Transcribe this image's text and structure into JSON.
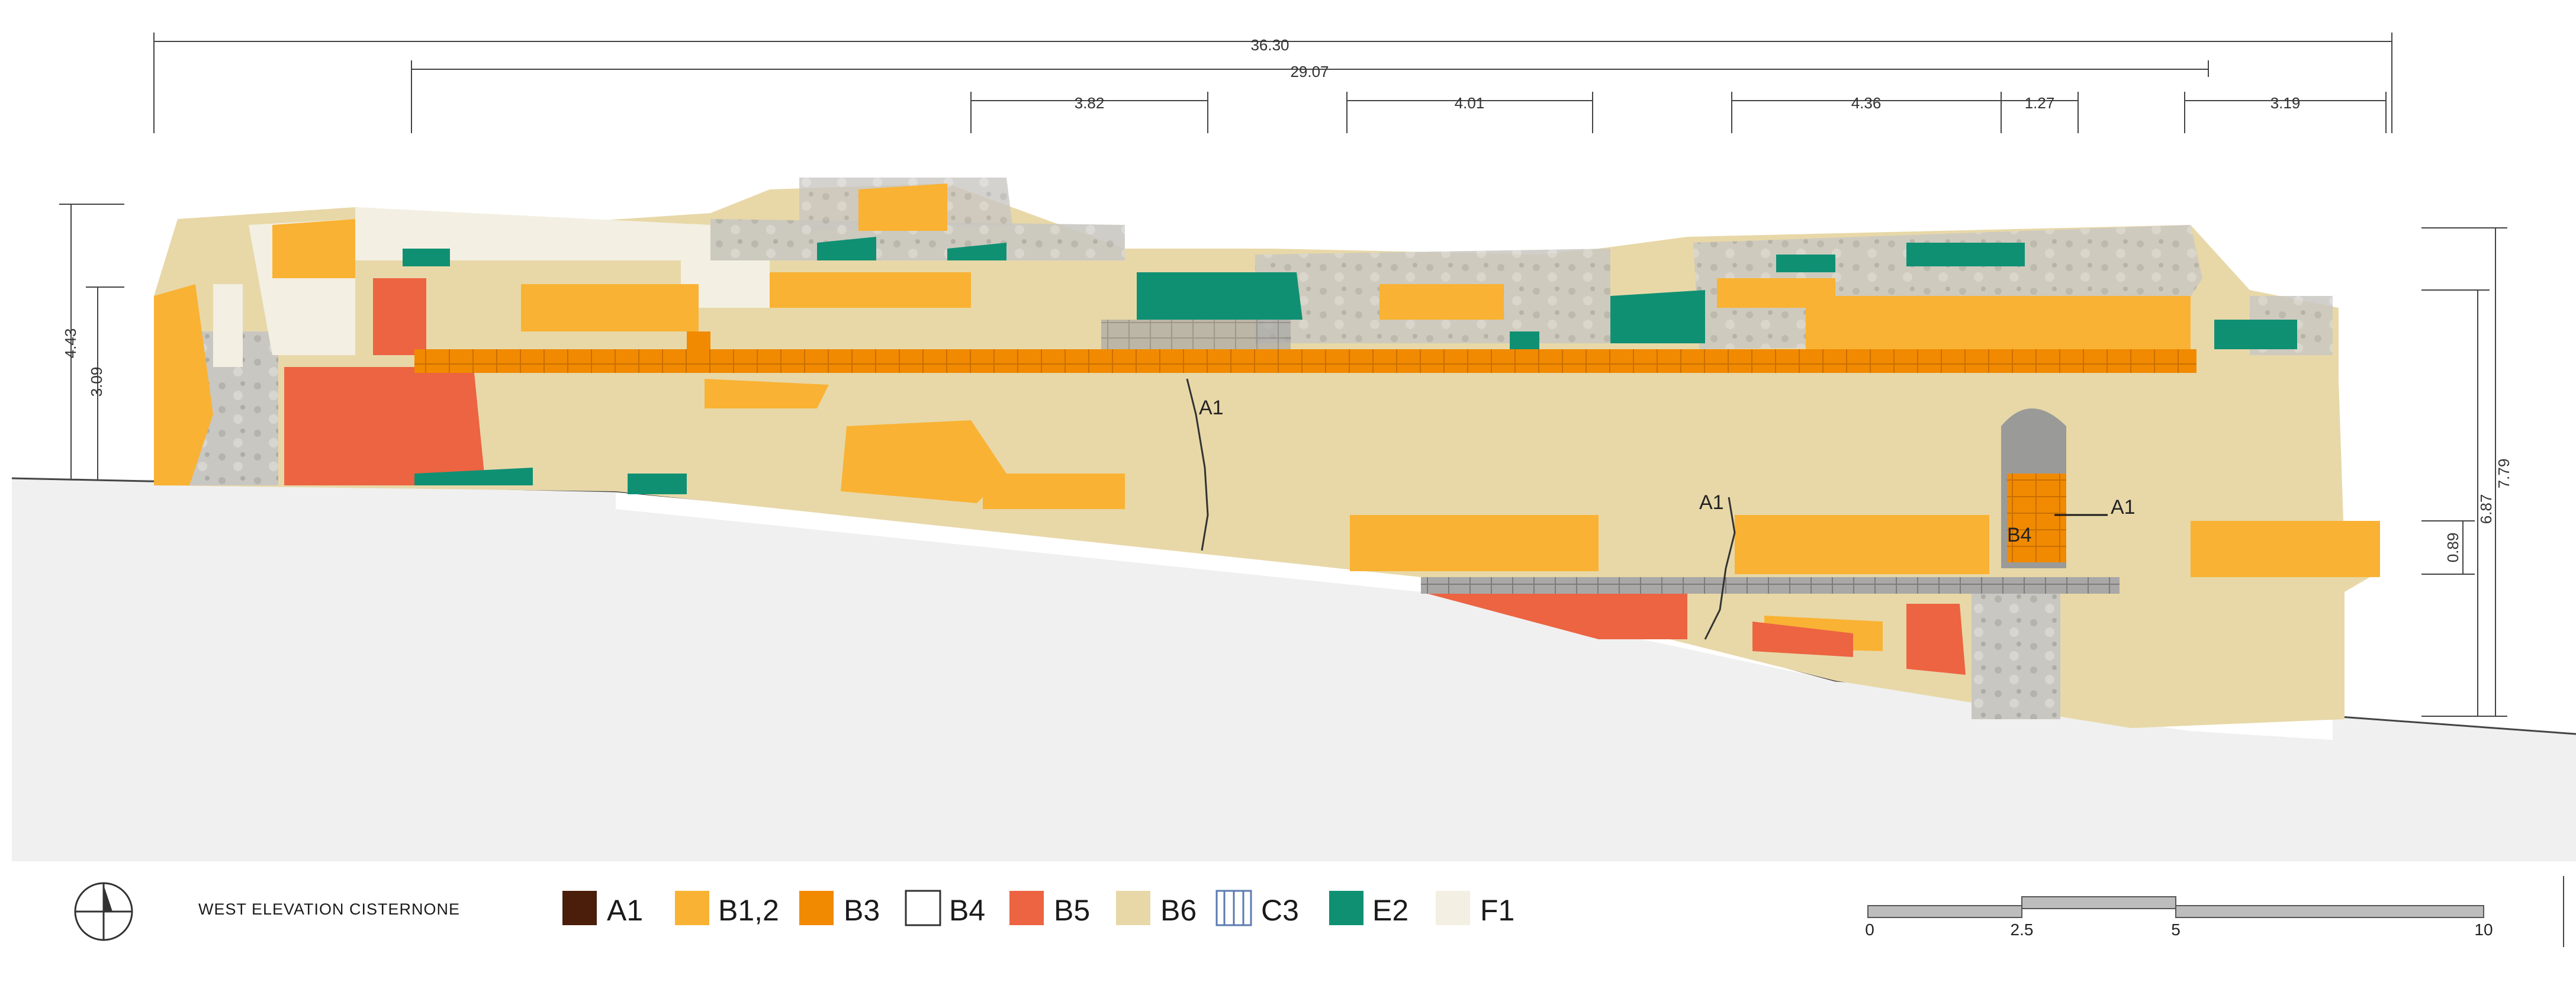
{
  "drawing_title": "WEST ELEVATION  CISTERNONE",
  "dimensions": {
    "overall": "36.30",
    "inner": "29.07",
    "segments": [
      "3.82",
      "4.01",
      "4.36",
      "1.27",
      "3.19"
    ],
    "left_heights": [
      "4.43",
      "3.09"
    ],
    "right_heights": [
      "7.79",
      "6.87",
      "0.89"
    ]
  },
  "annotations": [
    "A1",
    "A1",
    "A1",
    "B4"
  ],
  "legend": [
    {
      "code": "A1",
      "color": "#4a1e0a",
      "pattern": "solid"
    },
    {
      "code": "B1,2",
      "color": "#f9b233",
      "pattern": "solid"
    },
    {
      "code": "B3",
      "color": "#f18a00",
      "pattern": "solid"
    },
    {
      "code": "B4",
      "color": "#ffffff",
      "pattern": "outline"
    },
    {
      "code": "B5",
      "color": "#ec6442",
      "pattern": "solid"
    },
    {
      "code": "B6",
      "color": "#e8d8a8",
      "pattern": "solid"
    },
    {
      "code": "C3",
      "color": "#5b7bb0",
      "pattern": "vertical-lines"
    },
    {
      "code": "E2",
      "color": "#109073",
      "pattern": "solid"
    },
    {
      "code": "F1",
      "color": "#f3efe2",
      "pattern": "solid"
    }
  ],
  "scale_bar": {
    "ticks": [
      "0",
      "2.5",
      "5",
      "10"
    ]
  },
  "icons": {
    "north_arrow": "north-arrow-icon"
  }
}
